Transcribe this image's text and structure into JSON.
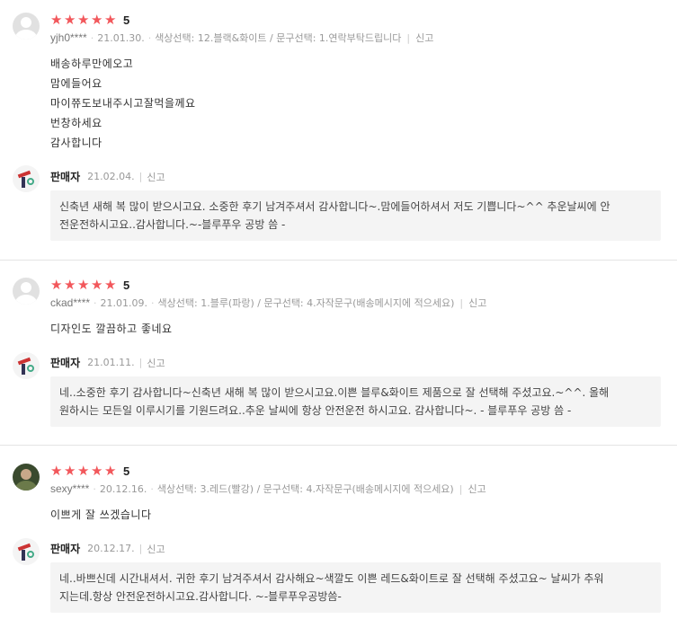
{
  "reviews": [
    {
      "rating": "5",
      "user": "yjh0****",
      "date": "21.01.30.",
      "options": "색상선택: 12.블랙&화이트 / 문구선택: 1.연락부탁드립니다",
      "report": "신고",
      "body": [
        "배송하루만에오고",
        "맘에들어요",
        "마이쮸도보내주시고잘먹을께요",
        "번창하세요",
        "감사합니다"
      ],
      "seller": {
        "name": "판매자",
        "date": "21.02.04.",
        "report": "신고",
        "reply": [
          "신축년 새해 복 많이 받으시고요. 소중한 후기 남겨주셔서 감사합니다~.맘에들어하셔서 저도 기쁩니다~^^ 추운날씨에 안",
          "전운전하시고요..감사합니다.~-블루푸우 공방 씀 -"
        ]
      }
    },
    {
      "rating": "5",
      "user": "ckad****",
      "date": "21.01.09.",
      "options": "색상선택: 1.블루(파랑) / 문구선택: 4.자작문구(배송메시지에 적으세요)",
      "report": "신고",
      "body": [
        "디자인도 깔끔하고 좋네요"
      ],
      "seller": {
        "name": "판매자",
        "date": "21.01.11.",
        "report": "신고",
        "reply": [
          "네..소중한 후기 감사합니다~신축년 새해 복 많이 받으시고요.이쁜 블루&화이트 제품으로 잘 선택해 주셨고요.~^^. 올해",
          "원하시는 모든일 이루시기를 기원드려요..추운 날씨에 항상 안전운전 하시고요. 감사합니다~. - 블루푸우 공방 씀 -"
        ]
      }
    },
    {
      "rating": "5",
      "user": "sexy****",
      "date": "20.12.16.",
      "options": "색상선택: 3.레드(빨강) / 문구선택: 4.자작문구(배송메시지에 적으세요)",
      "report": "신고",
      "body": [
        "이쁘게 잘 쓰겠습니다"
      ],
      "seller": {
        "name": "판매자",
        "date": "20.12.17.",
        "report": "신고",
        "reply": [
          "네..바쁘신데 시간내셔서. 귀한 후기 남겨주셔서 감사해요~색깔도 이쁜 레드&화이트로 잘 선택해 주셨고요~ 날씨가 추워",
          "지는데.항상 안전운전하시고요.감사합니다. ~-블루푸우공방씀-"
        ]
      }
    }
  ],
  "colors": {
    "star": "#f2575b",
    "reply_bg": "#f4f4f4",
    "divider": "#e4e4e4"
  },
  "icons": {
    "star": "star-icon",
    "default_avatar": "default-avatar-icon"
  }
}
